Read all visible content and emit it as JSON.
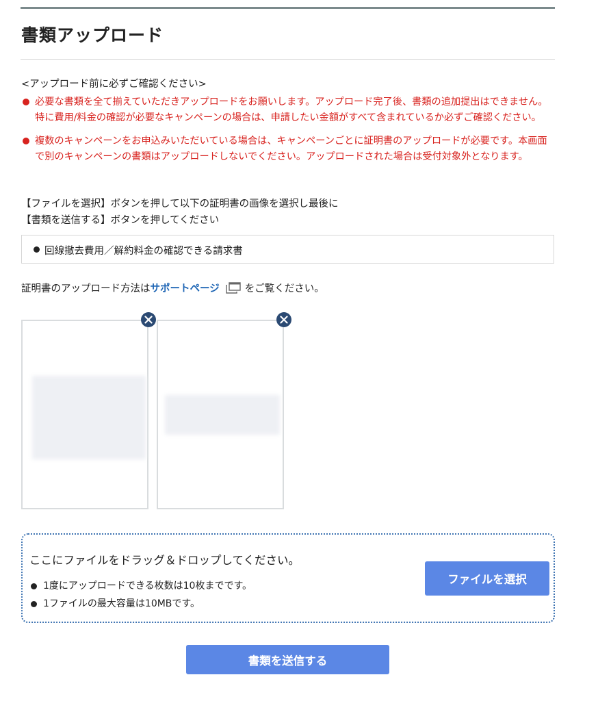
{
  "page": {
    "title": "書類アップロード"
  },
  "notice": {
    "heading": "<アップロード前に必ずご確認ください>",
    "warnings": [
      "必要な書類を全て揃えていただきアップロードをお願いします。アップロード完了後、書類の追加提出はできません。特に費用/料金の確認が必要なキャンペーンの場合は、申請したい金額がすべて含まれているか必ずご確認ください。",
      "複数のキャンペーンをお申込みいただいている場合は、キャンペーンごとに証明書のアップロードが必要です。本画面で別のキャンペーンの書類はアップロードしないでください。アップロードされた場合は受付対象外となります。"
    ]
  },
  "instruction": {
    "line1": "【ファイルを選択】ボタンを押して以下の証明書の画像を選択し最後に",
    "line2": "【書類を送信する】ボタンを押してください"
  },
  "required_docs": {
    "item": "回線撤去費用／解約料金の確認できる請求書"
  },
  "howto": {
    "prefix": "証明書のアップロード方法は",
    "link": "サポートページ",
    "suffix": "をご覧ください。"
  },
  "dropzone": {
    "title": "ここにファイルをドラッグ＆ドロップしてください。",
    "notes": [
      "1度にアップロードできる枚数は10枚までです。",
      "1ファイルの最大容量は10MBです。"
    ],
    "select_button": "ファイルを選択"
  },
  "submit": {
    "label": "書類を送信する"
  },
  "colors": {
    "warning": "#d8231f",
    "link": "#1f66b5",
    "button": "#5b87e5",
    "remove_badge": "#2b4a73",
    "dropzone_border": "#3f74b2"
  },
  "icons": {
    "external_window": "external-window-icon",
    "remove": "close-icon"
  }
}
